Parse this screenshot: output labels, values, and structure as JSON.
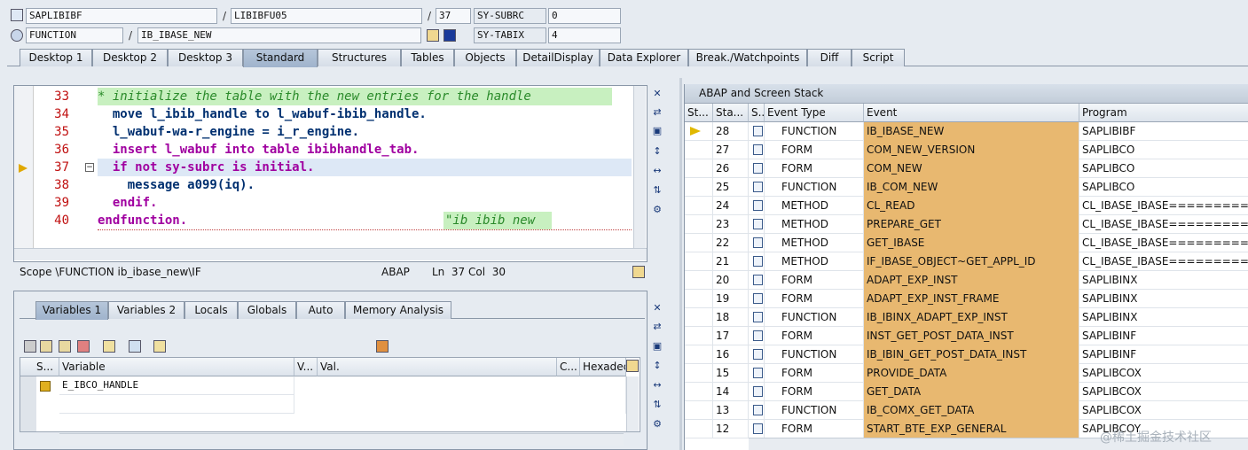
{
  "header": {
    "program": "SAPLIBIBF",
    "include": "LIBIBFU05",
    "line": "37",
    "subrc_label": "SY-SUBRC",
    "subrc_value": "0",
    "event_type": "FUNCTION",
    "event": "IB_IBASE_NEW",
    "tabix_label": "SY-TABIX",
    "tabix_value": "4",
    "separator": "/"
  },
  "tabs": [
    "Desktop 1",
    "Desktop 2",
    "Desktop 3",
    "Standard",
    "Structures",
    "Tables",
    "Objects",
    "DetailDisplay",
    "Data Explorer",
    "Break./Watchpoints",
    "Diff",
    "Script"
  ],
  "active_tab": "Standard",
  "code": {
    "lines": [
      {
        "num": "33",
        "html": "comment",
        "text": "* initialize the table with the new entries for the handle"
      },
      {
        "num": "34",
        "text": "  move l_ibib_handle to l_wabuf-ibib_handle."
      },
      {
        "num": "35",
        "text": "  l_wabuf-wa-r_engine = i_r_engine."
      },
      {
        "num": "36",
        "text": "  insert l_wabuf into table ibibhandle_tab."
      },
      {
        "num": "37",
        "text": "  if not sy-subrc is initial."
      },
      {
        "num": "38",
        "text": "    message a099(iq)."
      },
      {
        "num": "39",
        "text": "  endif."
      },
      {
        "num": "40",
        "text": "endfunction."
      }
    ],
    "trailing_comment": "\"ib ibib new",
    "status_scope": "Scope \\FUNCTION ib_ibase_new\\IF",
    "status_lang": "ABAP",
    "status_pos": "Ln  37 Col  30"
  },
  "stack": {
    "title": "ABAP and Screen Stack",
    "columns": [
      "St...",
      "Sta...",
      "S...",
      "Event Type",
      "Event",
      "Program"
    ],
    "rows": [
      {
        "level": "28",
        "type": "FUNCTION",
        "event": "IB_IBASE_NEW",
        "program": "SAPLIBIBF",
        "current": true
      },
      {
        "level": "27",
        "type": "FORM",
        "event": "COM_NEW_VERSION",
        "program": "SAPLIBCO"
      },
      {
        "level": "26",
        "type": "FORM",
        "event": "COM_NEW",
        "program": "SAPLIBCO"
      },
      {
        "level": "25",
        "type": "FUNCTION",
        "event": "IB_COM_NEW",
        "program": "SAPLIBCO"
      },
      {
        "level": "24",
        "type": "METHOD",
        "event": "CL_READ",
        "program": "CL_IBASE_IBASE============"
      },
      {
        "level": "23",
        "type": "METHOD",
        "event": "PREPARE_GET",
        "program": "CL_IBASE_IBASE============"
      },
      {
        "level": "22",
        "type": "METHOD",
        "event": "GET_IBASE",
        "program": "CL_IBASE_IBASE============"
      },
      {
        "level": "21",
        "type": "METHOD",
        "event": "IF_IBASE_OBJECT~GET_APPL_ID",
        "program": "CL_IBASE_IBASE============"
      },
      {
        "level": "20",
        "type": "FORM",
        "event": "ADAPT_EXP_INST",
        "program": "SAPLIBINX"
      },
      {
        "level": "19",
        "type": "FORM",
        "event": "ADAPT_EXP_INST_FRAME",
        "program": "SAPLIBINX"
      },
      {
        "level": "18",
        "type": "FUNCTION",
        "event": "IB_IBINX_ADAPT_EXP_INST",
        "program": "SAPLIBINX"
      },
      {
        "level": "17",
        "type": "FORM",
        "event": "INST_GET_POST_DATA_INST",
        "program": "SAPLIBINF"
      },
      {
        "level": "16",
        "type": "FUNCTION",
        "event": "IB_IBIN_GET_POST_DATA_INST",
        "program": "SAPLIBINF"
      },
      {
        "level": "15",
        "type": "FORM",
        "event": "PROVIDE_DATA",
        "program": "SAPLIBCOX"
      },
      {
        "level": "14",
        "type": "FORM",
        "event": "GET_DATA",
        "program": "SAPLIBCOX"
      },
      {
        "level": "13",
        "type": "FUNCTION",
        "event": "IB_COMX_GET_DATA",
        "program": "SAPLIBCOX"
      },
      {
        "level": "12",
        "type": "FORM",
        "event": "START_BTE_EXP_GENERAL",
        "program": "SAPLIBCOY"
      }
    ]
  },
  "variables": {
    "tabs": [
      "Variables 1",
      "Variables 2",
      "Locals",
      "Globals",
      "Auto",
      "Memory Analysis"
    ],
    "active_tab": "Variables 1",
    "columns": [
      "S...",
      "Variable",
      "V...",
      "Val.",
      "C...",
      "Hexadec"
    ],
    "rows": [
      {
        "name": "E_IBCO_HANDLE"
      }
    ]
  },
  "watermark": "@稀土掘金技术社区",
  "colors": {
    "event_highlight": "#e8b870",
    "active_tab": "#9fb3cc",
    "comment_bg": "#c8f0c0"
  }
}
